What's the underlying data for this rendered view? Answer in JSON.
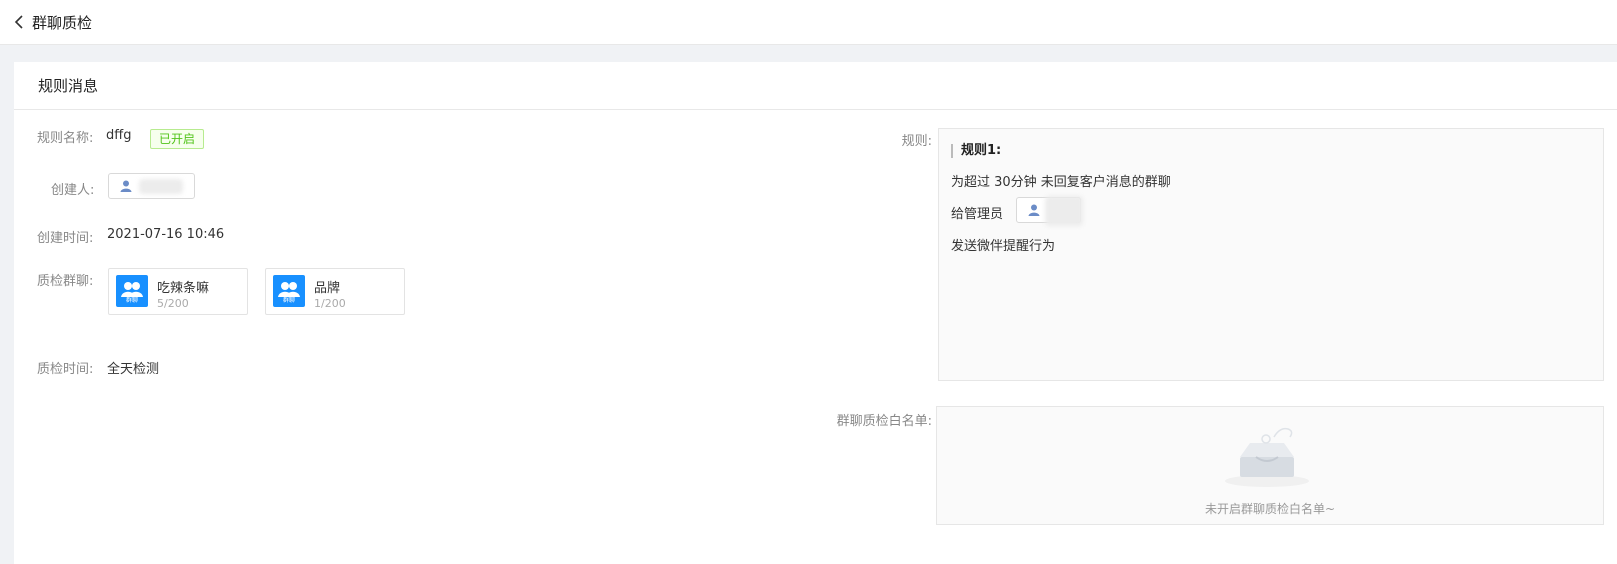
{
  "topbar": {
    "title": "群聊质检"
  },
  "card": {
    "title": "规则消息"
  },
  "fields": {
    "rule_name_label": "规则名称:",
    "rule_name": "dffg",
    "status": "已开启",
    "creator_label": "创建人:",
    "created_time_label": "创建时间:",
    "created_time": "2021-07-16 10:46",
    "groups_label": "质检群聊:",
    "inspect_time_label": "质检时间:",
    "inspect_time": "全天检测"
  },
  "groups": [
    {
      "name": "吃辣条嘛",
      "count": "5/200",
      "badge": "群聊"
    },
    {
      "name": "品牌",
      "count": "1/200",
      "badge": "群聊"
    }
  ],
  "rules": {
    "label": "规则:",
    "title": "规则1:",
    "line1": "为超过  30分钟  未回复客户消息的群聊",
    "line2_prefix": "给管理员",
    "line3": "发送微伴提醒行为"
  },
  "whitelist": {
    "label": "群聊质检白名单:",
    "empty_text": "未开启群聊质检白名单~"
  },
  "colors": {
    "accent": "#1890ff",
    "status_green": "#52c41a",
    "status_bg": "#f6ffed"
  }
}
